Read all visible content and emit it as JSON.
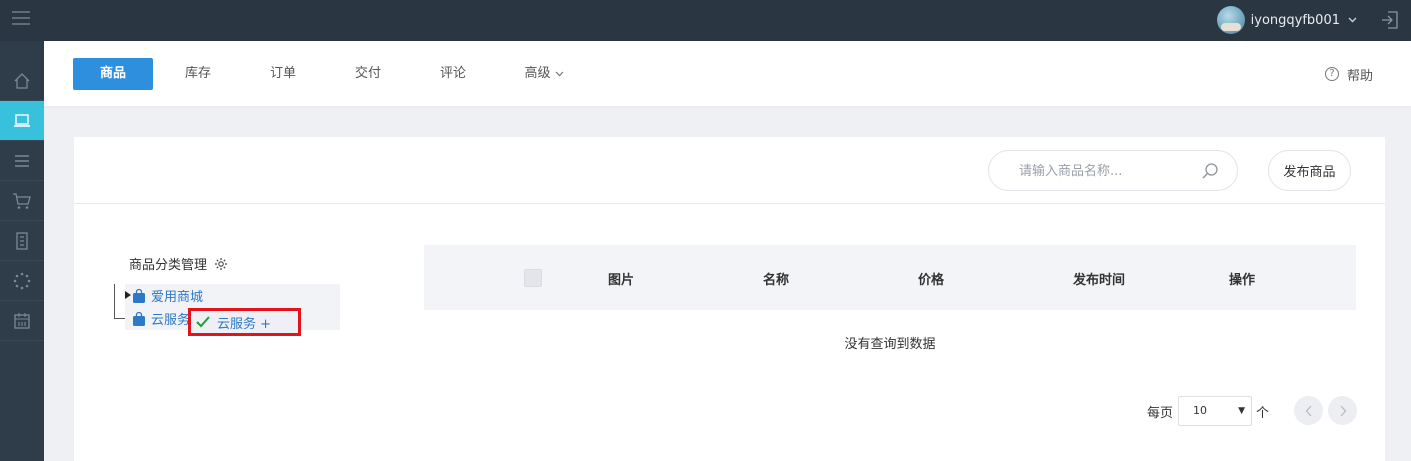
{
  "topbar": {
    "menu_icon": "hamburger-icon",
    "username": "iyongqyfb001",
    "user_caret": "chevron-down-icon",
    "logout_icon": "logout-icon"
  },
  "rail": {
    "items": [
      {
        "icon": "home-icon"
      },
      {
        "icon": "laptop-icon",
        "active": true
      },
      {
        "icon": "list-icon"
      },
      {
        "icon": "cart-icon"
      },
      {
        "icon": "building-icon"
      },
      {
        "icon": "loading-icon"
      },
      {
        "icon": "calendar-icon"
      }
    ]
  },
  "tabs": [
    {
      "label": "商品",
      "active": true
    },
    {
      "label": "库存"
    },
    {
      "label": "订单"
    },
    {
      "label": "交付"
    },
    {
      "label": "评论"
    },
    {
      "label": "高级",
      "dropdown": true
    }
  ],
  "help": {
    "label": "帮助",
    "icon_text": "?"
  },
  "search": {
    "placeholder": "请输入商品名称..."
  },
  "publish_label": "发布商品",
  "category": {
    "title": "商品分类管理",
    "items": [
      {
        "label": "爱用商城"
      },
      {
        "label": "云服务"
      }
    ],
    "drag_tooltip": "云服务 +"
  },
  "table": {
    "columns": [
      "图片",
      "名称",
      "价格",
      "发布时间",
      "操作"
    ],
    "empty_text": "没有查询到数据"
  },
  "pagination": {
    "per_page_prefix": "每页",
    "per_page_value": "10",
    "per_page_suffix": "个"
  },
  "colors": {
    "accent": "#2f8fdf",
    "rail_active": "#37c1dc",
    "topbar": "#2b3643",
    "highlight_border": "#e3131b"
  }
}
